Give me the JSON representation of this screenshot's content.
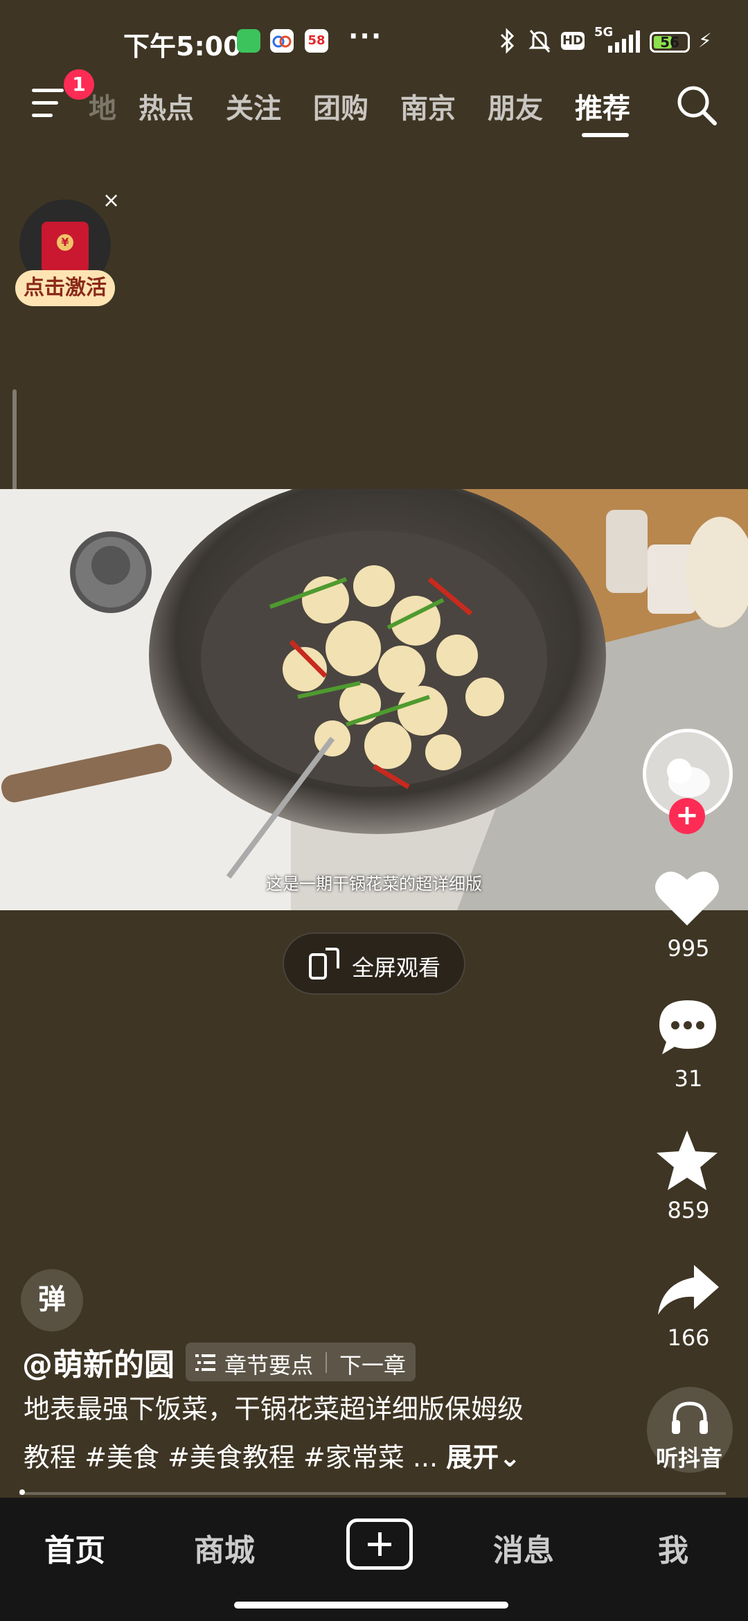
{
  "status_bar": {
    "time": "下午5:00",
    "network": "5G",
    "battery": "56",
    "battery_fraction": 0.56,
    "hd_label": "HD",
    "app_icon_58": "58"
  },
  "top_nav": {
    "menu_badge": "1",
    "tabs": [
      {
        "label": "地"
      },
      {
        "label": "热点"
      },
      {
        "label": "关注"
      },
      {
        "label": "团购"
      },
      {
        "label": "南京"
      },
      {
        "label": "朋友"
      },
      {
        "label": "推荐"
      }
    ]
  },
  "red_packet": {
    "label": "点击激活",
    "close": "×"
  },
  "video": {
    "subtitle": "这是一期干锅花菜的超详细版",
    "fullscreen_label": "全屏观看"
  },
  "rail": {
    "follow": "+",
    "likes": "995",
    "comments": "31",
    "favorites": "859",
    "shares": "166",
    "music_label": "听抖音"
  },
  "post": {
    "danmu": "弹",
    "author": "@萌新的圆",
    "chapter_points": "章节要点",
    "next_chapter": "下一章",
    "desc_line1": "地表最强下饭菜，干锅花菜超详细版保姆级",
    "desc_line2": "教程 #美食 #美食教程 #家常菜 ...",
    "expand": "展开"
  },
  "bottom_nav": {
    "home": "首页",
    "mall": "商城",
    "messages": "消息",
    "me": "我"
  },
  "colors": {
    "background": "#3e3524",
    "accent": "#fe2c55",
    "nav_bg": "#161616"
  }
}
